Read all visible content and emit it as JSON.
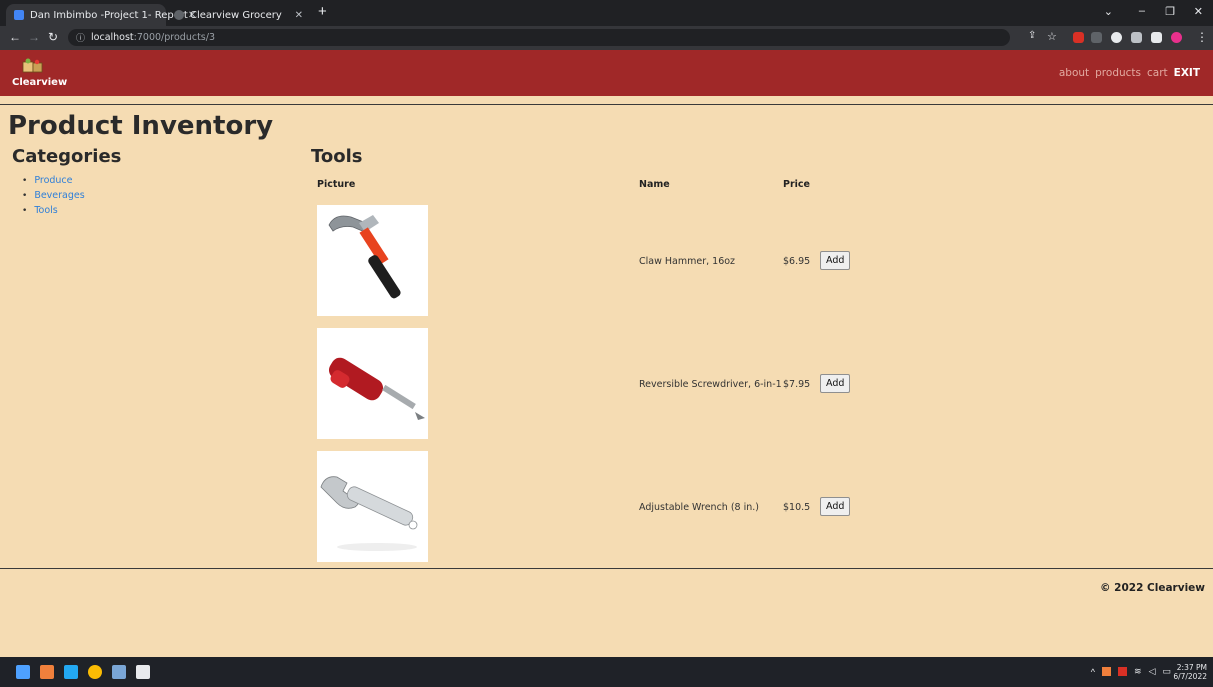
{
  "browser": {
    "tabs": [
      {
        "title": "Dan Imbimbo -Project 1- Report",
        "icon": "docs-icon",
        "color": "#4285f4"
      },
      {
        "title": "Clearview Grocery",
        "icon": "globe-icon",
        "color": "#9aa0a6"
      }
    ],
    "url_host": "localhost",
    "url_path": ":7000/products/3"
  },
  "site": {
    "brand": "Clearview",
    "nav": [
      "about",
      "products",
      "cart",
      "EXIT"
    ],
    "header_color": "#a02828",
    "background_color": "#f5dcb3",
    "link_color": "#2f7fd8"
  },
  "page": {
    "title": "Product Inventory",
    "categories_title": "Categories",
    "categories": [
      "Produce",
      "Beverages",
      "Tools"
    ],
    "section_title": "Tools",
    "headers": {
      "picture": "Picture",
      "name": "Name",
      "price": "Price"
    },
    "products": [
      {
        "name": "Claw Hammer, 16oz",
        "price": "$6.95",
        "image": "hammer",
        "action": "Add"
      },
      {
        "name": "Reversible Screwdriver, 6-in-1",
        "price": "$7.95",
        "image": "screwdriver",
        "action": "Add"
      },
      {
        "name": "Adjustable Wrench (8 in.)",
        "price": "$10.5",
        "image": "wrench",
        "action": "Add"
      }
    ],
    "footer": "© 2022 Clearview"
  },
  "taskbar": {
    "time": "2:37 PM",
    "date": "6/7/2022"
  }
}
